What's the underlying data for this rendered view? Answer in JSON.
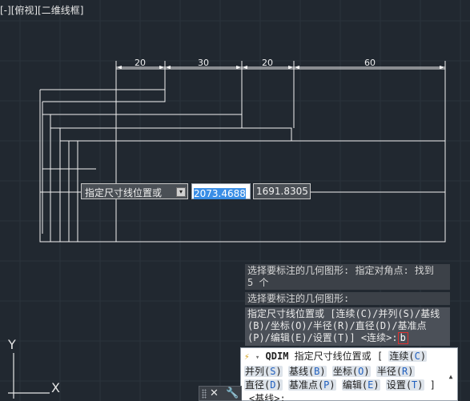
{
  "viewport": {
    "label": "[-][俯视][二维线框]"
  },
  "dimensions": [
    "20",
    "30",
    "20",
    "60"
  ],
  "dynamic_input": {
    "prompt": "指定尺寸线位置或",
    "active_value": "2073.4688",
    "other_value": "1691.8305"
  },
  "history": {
    "line1": "选择要标注的几何图形: 指定对角点: 找到",
    "line1b": "5 个",
    "line2": "选择要标注的几何图形:",
    "line3a": "指定尺寸线位置或 [连续(C)/并列(S)/基线",
    "line3b": "(B)/坐标(O)/半径(R)/直径(D)/基准点",
    "line3c": "(P)/编辑(E)/设置(T)] <连续>:",
    "typed": "b"
  },
  "command_line": {
    "command": "QDIM",
    "prompt": "指定尺寸线位置或 [",
    "options_row1": [
      {
        "text": "连续(",
        "key": "C",
        "end": ")"
      }
    ],
    "options_row2": [
      {
        "text": "并列(",
        "key": "S",
        "end": ")"
      },
      {
        "text": "基线(",
        "key": "B",
        "end": ")"
      },
      {
        "text": "坐标(",
        "key": "O",
        "end": ")"
      },
      {
        "text": "半径(",
        "key": "R",
        "end": ")"
      }
    ],
    "options_row3": [
      {
        "text": "直径(",
        "key": "D",
        "end": ")"
      },
      {
        "text": "基准点(",
        "key": "P",
        "end": ")"
      },
      {
        "text": "编辑(",
        "key": "E",
        "end": ")"
      },
      {
        "text": "设置(",
        "key": "T",
        "end": ")"
      }
    ],
    "close_bracket": "]",
    "next_hint": "<基线>:"
  },
  "ucs": {
    "x_label": "X",
    "y_label": "Y"
  },
  "colors": {
    "background": "#212830",
    "grid": "#2b333c",
    "lines": "#f2f2f2",
    "highlight": "#3a8ee6",
    "cursor_box": "#e03030"
  },
  "icons": {
    "close": "close-icon",
    "settings": "wrench-icon",
    "command": "command-prompt-icon"
  }
}
